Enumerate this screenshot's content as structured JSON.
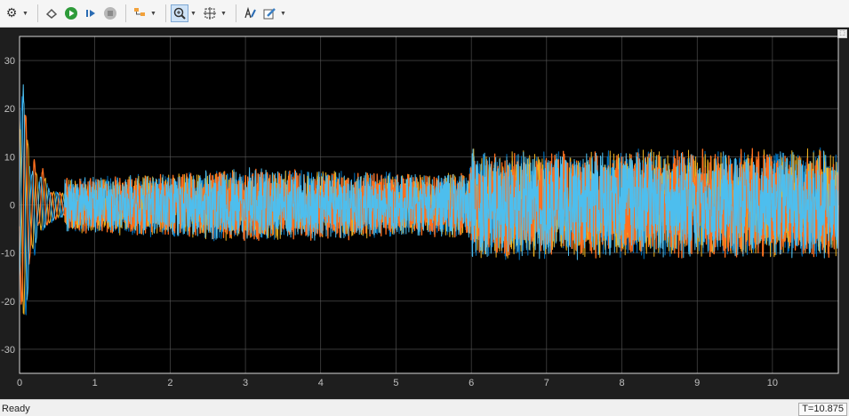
{
  "toolbar": {
    "icons": [
      "gear-icon",
      "highlight-block-icon",
      "run-icon",
      "step-forward-icon",
      "stop-icon",
      "signal-selector-icon",
      "zoom-in-icon",
      "autoscale-icon",
      "style-icon",
      "properties-icon"
    ]
  },
  "status": {
    "text": "Ready",
    "time": "T=10.875"
  },
  "colors": {
    "background": "#1e1e1e",
    "axes_bg": "#000000",
    "grid": "#5a5a5a",
    "tick": "#c0c0c0",
    "series": [
      "#0072bd",
      "#edb120",
      "#ff6f1f",
      "#4dbeee"
    ]
  },
  "chart_data": {
    "type": "line",
    "title": "",
    "xlabel": "",
    "ylabel": "",
    "xlim": [
      0,
      10.875
    ],
    "ylim": [
      -35,
      35
    ],
    "xticks": [
      0,
      1,
      2,
      3,
      4,
      5,
      6,
      7,
      8,
      9,
      10
    ],
    "yticks": [
      -30,
      -20,
      -10,
      0,
      10,
      20,
      30
    ],
    "grid": true,
    "envelope": {
      "t": [
        0,
        0.05,
        0.1,
        0.15,
        0.2,
        0.25,
        0.3,
        0.4,
        0.5,
        1.0,
        2.0,
        3.0,
        4.0,
        5.0,
        5.95,
        6.0,
        6.05,
        7.0,
        8.0,
        9.0,
        10.0,
        10.875
      ],
      "upper": [
        18,
        28,
        20,
        8,
        14,
        6,
        12,
        6,
        6,
        6,
        7,
        8,
        7.5,
        7,
        7,
        13,
        11.5,
        11.5,
        12,
        12,
        12,
        12
      ],
      "lower": [
        -18,
        -27,
        -26,
        -10,
        -15,
        -6,
        -10,
        -7,
        -6,
        -6,
        -7,
        -8,
        -7.5,
        -7,
        -7,
        -12.5,
        -11.5,
        -11.5,
        -11.5,
        -11.5,
        -11.5,
        -11.5
      ]
    },
    "series": [
      {
        "color": "#0072bd"
      },
      {
        "color": "#edb120"
      },
      {
        "color": "#ff6f1f"
      },
      {
        "color": "#4dbeee"
      }
    ]
  }
}
